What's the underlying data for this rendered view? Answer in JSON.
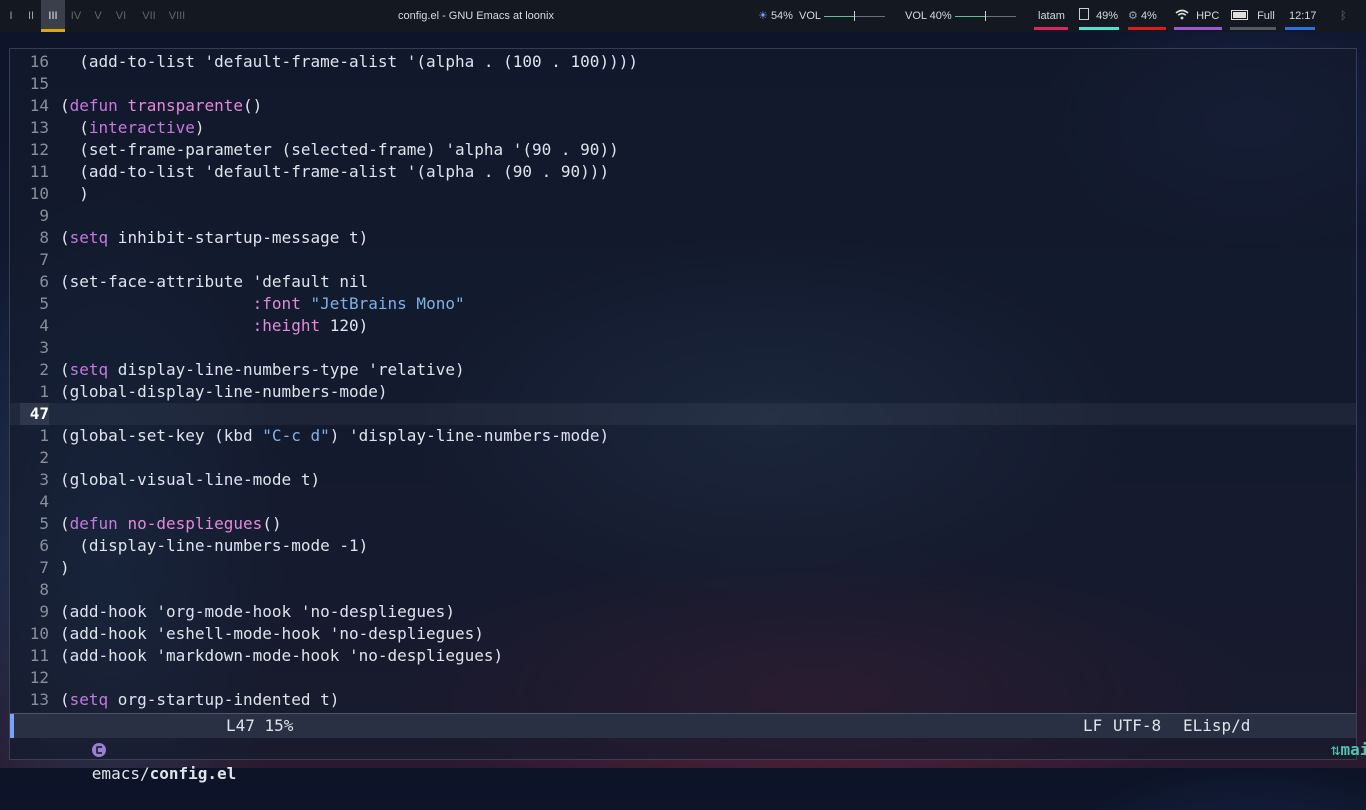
{
  "workspaces": [
    {
      "label": "I",
      "state": "occupied"
    },
    {
      "label": "II",
      "state": "occupied"
    },
    {
      "label": "III",
      "state": "active"
    },
    {
      "label": "IV",
      "state": "empty"
    },
    {
      "label": "V",
      "state": "empty"
    },
    {
      "label": "VI",
      "state": "empty"
    },
    {
      "label": "VII",
      "state": "empty"
    },
    {
      "label": "VIII",
      "state": "empty"
    }
  ],
  "window_title": "config.el - GNU Emacs at loonix",
  "status": {
    "brightness": "54%",
    "vol1_label": "VOL",
    "vol2_label": "VOL 40%",
    "keyboard": "latam",
    "memory": "49%",
    "cpu": "4%",
    "wifi": "HPC",
    "battery": "Full",
    "clock": "12:17",
    "underline_colors": {
      "keyboard": "#e0245e",
      "memory": "#4fe0d0",
      "cpu": "#d81b1b",
      "wifi": "#9b59d0",
      "battery": "#555a66",
      "clock": "#2f6fe0"
    }
  },
  "icons": {
    "brightness": "brightness-icon",
    "memory": "memory-chip-icon",
    "cpu": "cpu-gear-icon",
    "wifi": "wifi-icon",
    "battery": "battery-icon",
    "bluetooth": "bluetooth-icon",
    "vcs": "git-branch-icon",
    "emacs": "emacs-logo-icon"
  },
  "editor": {
    "lines": [
      {
        "num": "16",
        "current": false,
        "tokens": [
          {
            "t": "  (add-to-list 'default-frame-alist '(alpha . (100 . 100))))",
            "c": ""
          }
        ]
      },
      {
        "num": "15",
        "current": false,
        "tokens": []
      },
      {
        "num": "14",
        "current": false,
        "tokens": [
          {
            "t": "(",
            "c": ""
          },
          {
            "t": "defun",
            "c": "kw"
          },
          {
            "t": " ",
            "c": ""
          },
          {
            "t": "transparente",
            "c": "fn"
          },
          {
            "t": "()",
            "c": ""
          }
        ]
      },
      {
        "num": "13",
        "current": false,
        "tokens": [
          {
            "t": "  (",
            "c": ""
          },
          {
            "t": "interactive",
            "c": "kw"
          },
          {
            "t": ")",
            "c": ""
          }
        ]
      },
      {
        "num": "12",
        "current": false,
        "tokens": [
          {
            "t": "  (set-frame-parameter (selected-frame) 'alpha '(90 . 90))",
            "c": ""
          }
        ]
      },
      {
        "num": "11",
        "current": false,
        "tokens": [
          {
            "t": "  (add-to-list 'default-frame-alist '(alpha . (90 . 90)))",
            "c": ""
          }
        ]
      },
      {
        "num": "10",
        "current": false,
        "tokens": [
          {
            "t": "  )",
            "c": ""
          }
        ]
      },
      {
        "num": "9",
        "current": false,
        "tokens": []
      },
      {
        "num": "8",
        "current": false,
        "tokens": [
          {
            "t": "(",
            "c": ""
          },
          {
            "t": "setq",
            "c": "kw"
          },
          {
            "t": " inhibit-startup-message t)",
            "c": ""
          }
        ]
      },
      {
        "num": "7",
        "current": false,
        "tokens": []
      },
      {
        "num": "6",
        "current": false,
        "tokens": [
          {
            "t": "(set-face-attribute 'default nil",
            "c": ""
          }
        ]
      },
      {
        "num": "5",
        "current": false,
        "tokens": [
          {
            "t": "                    ",
            "c": ""
          },
          {
            "t": ":font",
            "c": "sym"
          },
          {
            "t": " ",
            "c": ""
          },
          {
            "t": "\"JetBrains Mono\"",
            "c": "str"
          }
        ]
      },
      {
        "num": "4",
        "current": false,
        "tokens": [
          {
            "t": "                    ",
            "c": ""
          },
          {
            "t": ":height",
            "c": "sym"
          },
          {
            "t": " 120)",
            "c": ""
          }
        ]
      },
      {
        "num": "3",
        "current": false,
        "tokens": []
      },
      {
        "num": "2",
        "current": false,
        "tokens": [
          {
            "t": "(",
            "c": ""
          },
          {
            "t": "setq",
            "c": "kw"
          },
          {
            "t": " display-line-numbers-type 'relative)",
            "c": ""
          }
        ]
      },
      {
        "num": "1",
        "current": false,
        "tokens": [
          {
            "t": "(global-display-line-numbers-mode)",
            "c": ""
          }
        ]
      },
      {
        "num": "47",
        "current": true,
        "tokens": []
      },
      {
        "num": "1",
        "current": false,
        "tokens": [
          {
            "t": "(global-set-key (kbd ",
            "c": ""
          },
          {
            "t": "\"C-c d\"",
            "c": "str"
          },
          {
            "t": ") 'display-line-numbers-mode)",
            "c": ""
          }
        ]
      },
      {
        "num": "2",
        "current": false,
        "tokens": []
      },
      {
        "num": "3",
        "current": false,
        "tokens": [
          {
            "t": "(global-visual-line-mode t)",
            "c": ""
          }
        ]
      },
      {
        "num": "4",
        "current": false,
        "tokens": []
      },
      {
        "num": "5",
        "current": false,
        "tokens": [
          {
            "t": "(",
            "c": ""
          },
          {
            "t": "defun",
            "c": "kw"
          },
          {
            "t": " ",
            "c": ""
          },
          {
            "t": "no-despliegues",
            "c": "fn"
          },
          {
            "t": "()",
            "c": ""
          }
        ]
      },
      {
        "num": "6",
        "current": false,
        "tokens": [
          {
            "t": "  (display-line-numbers-mode -1)",
            "c": ""
          }
        ]
      },
      {
        "num": "7",
        "current": false,
        "tokens": [
          {
            "t": ")",
            "c": ""
          }
        ]
      },
      {
        "num": "8",
        "current": false,
        "tokens": []
      },
      {
        "num": "9",
        "current": false,
        "tokens": [
          {
            "t": "(add-hook 'org-mode-hook 'no-despliegues)",
            "c": ""
          }
        ]
      },
      {
        "num": "10",
        "current": false,
        "tokens": [
          {
            "t": "(add-hook 'eshell-mode-hook 'no-despliegues)",
            "c": ""
          }
        ]
      },
      {
        "num": "11",
        "current": false,
        "tokens": [
          {
            "t": "(add-hook 'markdown-mode-hook 'no-despliegues)",
            "c": ""
          }
        ]
      },
      {
        "num": "12",
        "current": false,
        "tokens": []
      },
      {
        "num": "13",
        "current": false,
        "tokens": [
          {
            "t": "(",
            "c": ""
          },
          {
            "t": "setq",
            "c": "kw"
          },
          {
            "t": " org-startup-indented t)",
            "c": ""
          }
        ]
      }
    ]
  },
  "modeline": {
    "dir": "emacs/",
    "file": "config.el",
    "position": "L47 15%",
    "eol": "LF",
    "encoding": "UTF-8",
    "mode": "ELisp/d",
    "branch": "main"
  }
}
